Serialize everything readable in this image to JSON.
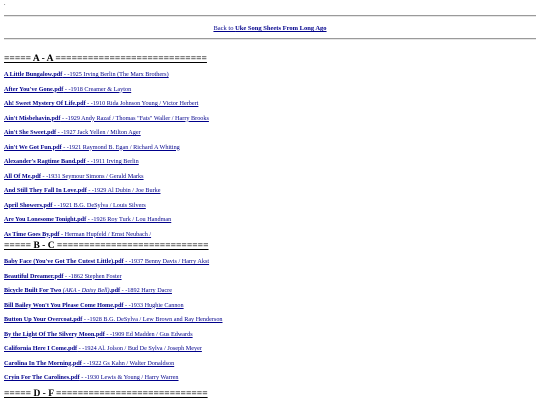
{
  "top_mark": ".",
  "back_link": {
    "prefix": "Back to ",
    "bold": "Uke Song Sheets From Long Ago"
  },
  "sections": [
    {
      "title": "===== A - A ============================",
      "entries": [
        {
          "file": "A Little Bungalow.pdf",
          "info": " - -1925 Irving Berlin (The Marx Brothers)"
        },
        {
          "file": "After You've Gone.pdf",
          "info": " - -1918 Creamer & Layton"
        },
        {
          "file": "Ah! Sweet Mystery Of Life.pdf",
          "info": " - -1910 Rida Johnson Young / Victor Herbert"
        },
        {
          "file": "Ain't Misbehavin.pdf",
          "info": " - -1929 Andy Razaf / Thomas \"Fats\" Waller / Harry Brooks"
        },
        {
          "file": "Ain't She Sweet.pdf",
          "info": " - -1927 Jack Yellen / Milton Ager"
        },
        {
          "file": "Ain't We Got Fun.pdf",
          "info": " - -1921 Raymond B. Egan / Richard A Whiting"
        },
        {
          "file": "Alexander's Ragtime Band.pdf",
          "info": " - -1911 Irving Berlin"
        },
        {
          "file": "All Of Me.pdf",
          "info": " - -1931 Seymour Simons / Gerald Marks"
        },
        {
          "file": "And Still They Fall In Love.pdf",
          "info": " - -1929 Al Dubin / Joe Burke"
        },
        {
          "file": "April Showers.pdf",
          "info": " - -1921 B.G. DeSylva / Louis Silvers"
        },
        {
          "file": "Are You Lonesome Tonight.pdf",
          "info": " - -1926 Roy Turk / Lou Handman"
        },
        {
          "file": "As Time Goes By.pdf",
          "info": " - Herman Hupfeld / Ernst Neubach /"
        }
      ]
    },
    {
      "title": "===== B - C ============================",
      "entries": [
        {
          "file": "Baby Face (You've Got The Cutest Little).pdf",
          "info": " - -1937 Benny Davis / Harry Akst"
        },
        {
          "file": "Beautiful Dreamer.pdf",
          "info": " - -1862 Stephen Foster"
        },
        {
          "file": "Bicycle Built For Two ",
          "aka": "(AKA - Daisy Bell)",
          "file2": ".pdf",
          "info": " - -1892 Harry Dacre"
        },
        {
          "file": "Bill Bailey Won't You Please Come Home.pdf",
          "info": " - -1933 Hughie Cannon"
        },
        {
          "file": "Button Up Your Overcoat.pdf",
          "info": " - -1928 B.G. DeSylva / Lew Brown and Ray Henderson"
        },
        {
          "file": "By the Light Of The Silvery Moon.pdf",
          "info": " - -1909 Ed Madden / Gus Edwards"
        },
        {
          "file": "California Here I Come.pdf",
          "info": " - -1924 Al. Jolson / Bud De Sylva / Joseph Meyer"
        },
        {
          "file": "Carolina In The Morning.pdf",
          "info": " - -1922 Gs Kahn / Walter Donaldson"
        },
        {
          "file": "Cryin For The Carolines.pdf",
          "info": " - -1930 Lewis & Young / Harry Warren"
        }
      ]
    },
    {
      "title": "===== D - F ============================",
      "entries": []
    }
  ]
}
